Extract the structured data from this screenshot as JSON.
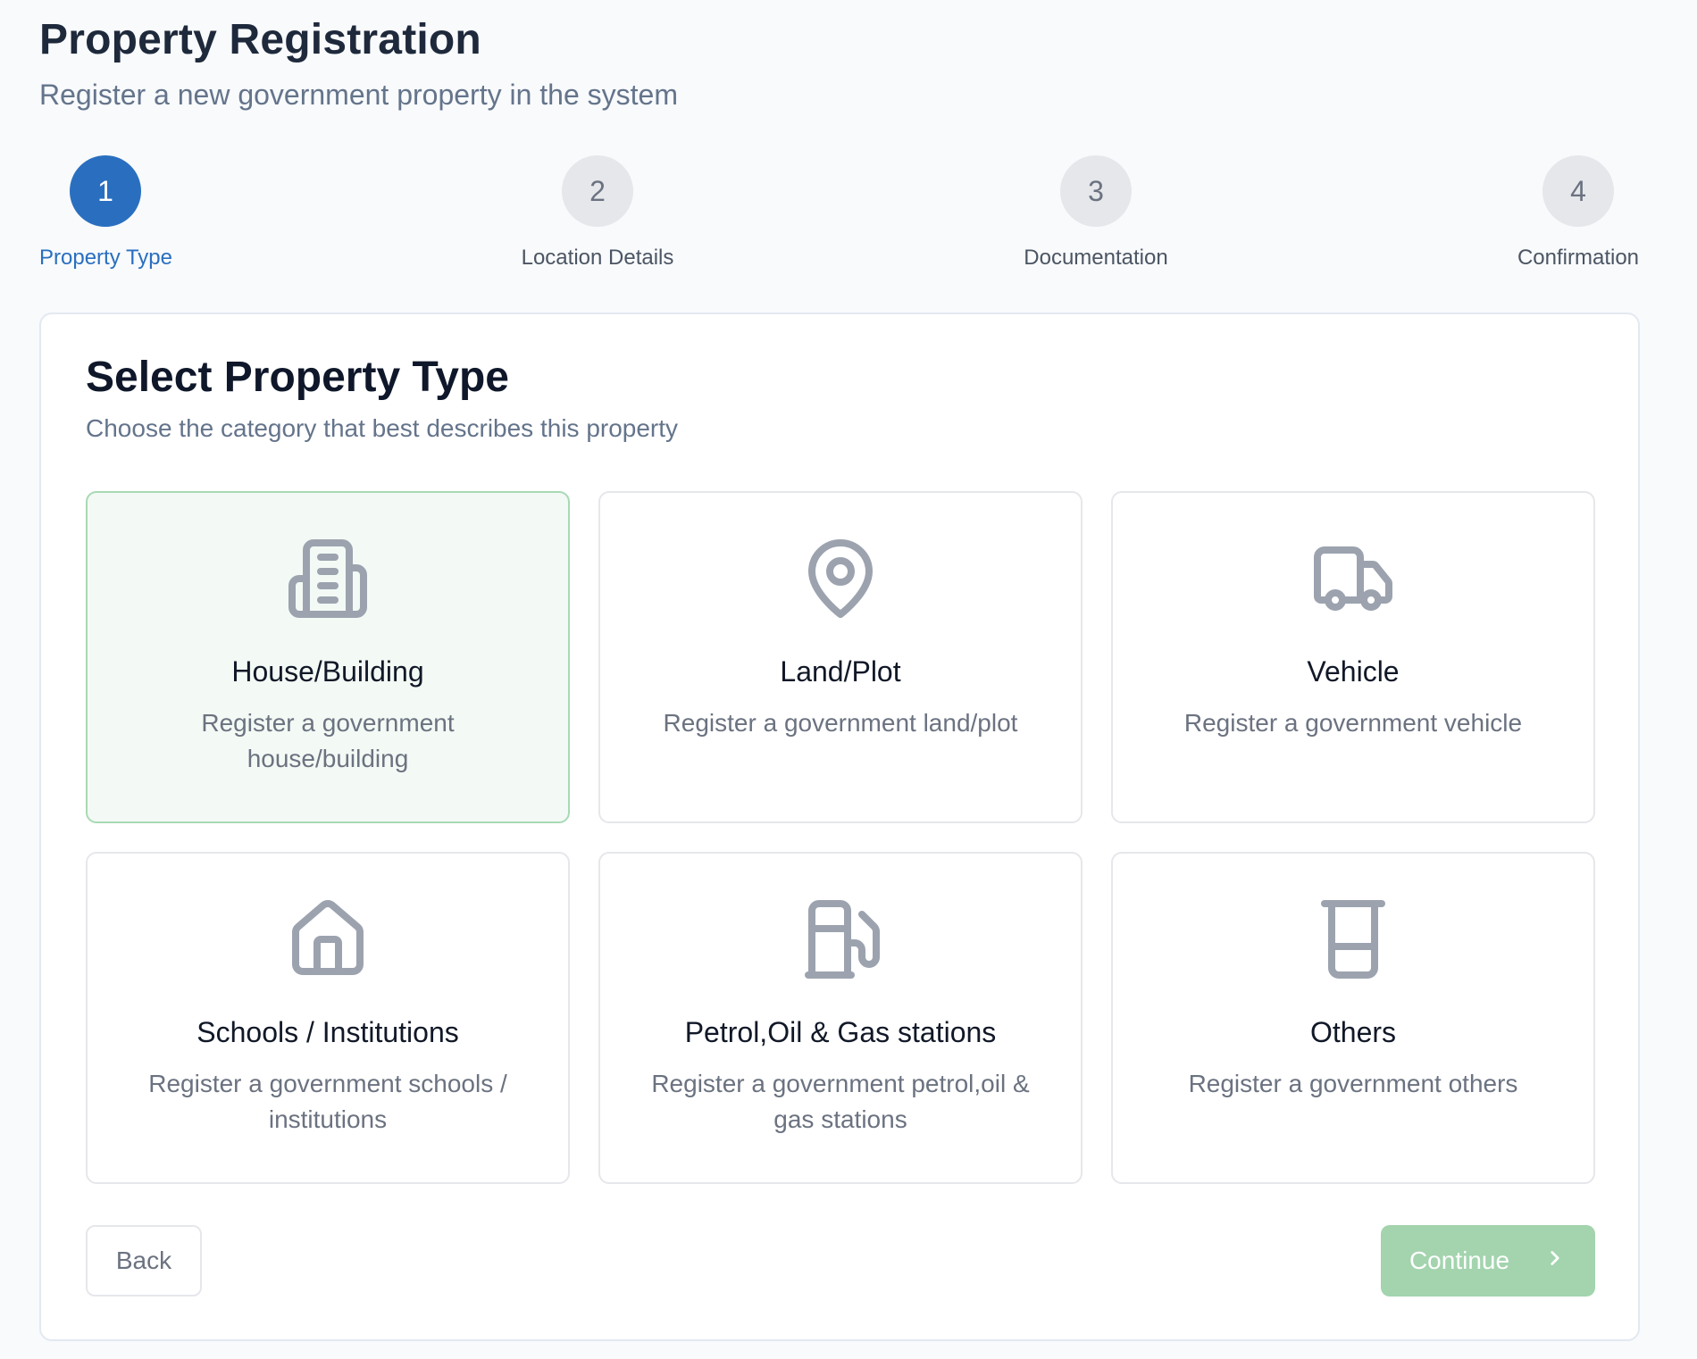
{
  "header": {
    "title": "Property Registration",
    "subtitle": "Register a new government property in the system"
  },
  "stepper": {
    "current_step": 1,
    "steps": [
      {
        "number": "1",
        "label": "Property Type"
      },
      {
        "number": "2",
        "label": "Location Details"
      },
      {
        "number": "3",
        "label": "Documentation"
      },
      {
        "number": "4",
        "label": "Confirmation"
      }
    ]
  },
  "section": {
    "title": "Select Property Type",
    "subtitle": "Choose the category that best describes this property"
  },
  "property_types": [
    {
      "icon": "building-icon",
      "title": "House/Building",
      "description": "Register a government house/building",
      "selected": true
    },
    {
      "icon": "map-pin-icon",
      "title": "Land/Plot",
      "description": "Register a government land/plot",
      "selected": false
    },
    {
      "icon": "truck-icon",
      "title": "Vehicle",
      "description": "Register a government vehicle",
      "selected": false
    },
    {
      "icon": "home-icon",
      "title": "Schools / Institutions",
      "description": "Register a government schools / institutions",
      "selected": false
    },
    {
      "icon": "fuel-icon",
      "title": "Petrol,Oil & Gas stations",
      "description": "Register a government petrol,oil & gas stations",
      "selected": false
    },
    {
      "icon": "container-icon",
      "title": "Others",
      "description": "Register a government others",
      "selected": false
    }
  ],
  "actions": {
    "back_label": "Back",
    "continue_label": "Continue",
    "continue_icon": "chevron-right-icon"
  },
  "colors": {
    "accent": "#2a6fbf",
    "selected_bg": "#f3f9f4",
    "selected_border": "#a8d9b5",
    "continue_bg": "#a3d4ae",
    "icon_gray": "#9ca3af"
  }
}
